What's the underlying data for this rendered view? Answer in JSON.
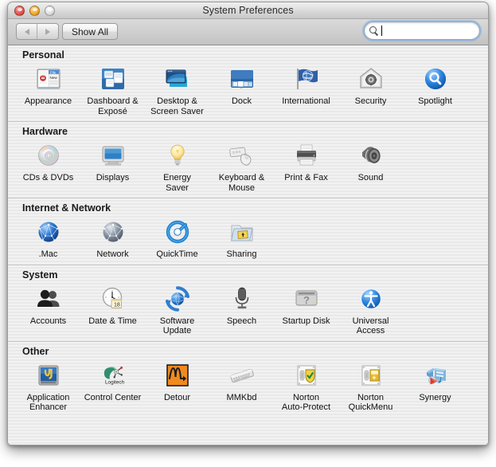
{
  "window": {
    "title": "System Preferences",
    "controls": {
      "close": "close-button",
      "minimize": "minimize-button",
      "zoom": "zoom-button"
    }
  },
  "toolbar": {
    "back_label": "Back",
    "forward_label": "Forward",
    "show_all_label": "Show All",
    "search": {
      "value": "",
      "placeholder": "",
      "icon": "search-icon",
      "focused": true
    }
  },
  "sections": [
    {
      "title": "Personal",
      "items": [
        {
          "label": "Appearance",
          "icon": "appearance-icon"
        },
        {
          "label": "Dashboard &\nExposé",
          "icon": "dashboard-expose-icon"
        },
        {
          "label": "Desktop &\nScreen Saver",
          "icon": "desktop-screen-saver-icon"
        },
        {
          "label": "Dock",
          "icon": "dock-icon"
        },
        {
          "label": "International",
          "icon": "international-icon"
        },
        {
          "label": "Security",
          "icon": "security-icon"
        },
        {
          "label": "Spotlight",
          "icon": "spotlight-icon"
        }
      ]
    },
    {
      "title": "Hardware",
      "items": [
        {
          "label": "CDs & DVDs",
          "icon": "cds-dvds-icon"
        },
        {
          "label": "Displays",
          "icon": "displays-icon"
        },
        {
          "label": "Energy\nSaver",
          "icon": "energy-saver-icon"
        },
        {
          "label": "Keyboard &\nMouse",
          "icon": "keyboard-mouse-icon"
        },
        {
          "label": "Print & Fax",
          "icon": "print-fax-icon"
        },
        {
          "label": "Sound",
          "icon": "sound-icon"
        }
      ]
    },
    {
      "title": "Internet & Network",
      "items": [
        {
          "label": ".Mac",
          "icon": "dotmac-icon"
        },
        {
          "label": "Network",
          "icon": "network-icon"
        },
        {
          "label": "QuickTime",
          "icon": "quicktime-icon"
        },
        {
          "label": "Sharing",
          "icon": "sharing-icon"
        }
      ]
    },
    {
      "title": "System",
      "items": [
        {
          "label": "Accounts",
          "icon": "accounts-icon"
        },
        {
          "label": "Date & Time",
          "icon": "date-time-icon"
        },
        {
          "label": "Software\nUpdate",
          "icon": "software-update-icon"
        },
        {
          "label": "Speech",
          "icon": "speech-icon"
        },
        {
          "label": "Startup Disk",
          "icon": "startup-disk-icon"
        },
        {
          "label": "Universal\nAccess",
          "icon": "universal-access-icon"
        }
      ]
    },
    {
      "title": "Other",
      "items": [
        {
          "label": "Application\nEnhancer",
          "icon": "application-enhancer-icon"
        },
        {
          "label": "Control Center",
          "icon": "logitech-control-center-icon"
        },
        {
          "label": "Detour",
          "icon": "detour-icon"
        },
        {
          "label": "MMKbd",
          "icon": "mmkbd-icon"
        },
        {
          "label": "Norton\nAuto-Protect",
          "icon": "norton-auto-protect-icon"
        },
        {
          "label": "Norton\nQuickMenu",
          "icon": "norton-quickmenu-icon"
        },
        {
          "label": "Synergy",
          "icon": "synergy-icon"
        }
      ]
    }
  ],
  "colors": {
    "accent_blue": "#1a6fd4",
    "window_bg": "#ececec",
    "close_red": "#e1534c",
    "minimize_amber": "#f0a92c",
    "zoom_gray": "#dcdcdc"
  }
}
